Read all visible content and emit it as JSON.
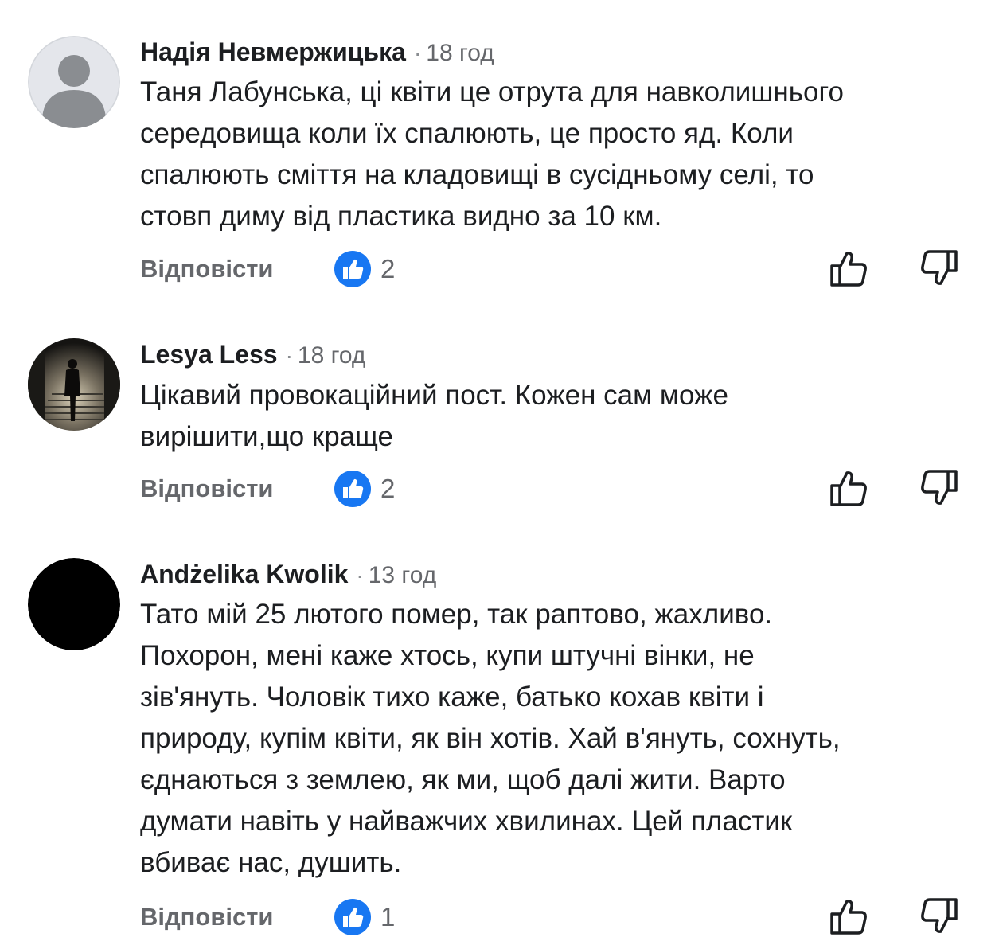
{
  "comments": [
    {
      "author": "Надія Невмержицька",
      "time": "18 год",
      "lines": [
        "Таня Лабунська, ці квіти це отрута для навколишнього",
        "середовища коли їх спалюють, це просто яд. Коли",
        "спалюють сміття на кладовищі в сусідньому селі, то",
        "стовп диму від пластика видно за 10 км."
      ],
      "reply_label": "Відповісти",
      "like_count": "2",
      "avatar": "default-person-avatar"
    },
    {
      "author": "Lesya Less",
      "time": "18 год",
      "lines": [
        "Цікавий провокаційний пост. Кожен сам може",
        "вирішити,що краще"
      ],
      "reply_label": "Відповісти",
      "like_count": "2",
      "avatar": "photo-avatar-stairs"
    },
    {
      "author": "Andżelika Kwolik",
      "time": "13 год",
      "lines": [
        "Тато мій 25 лютого помер, так раптово, жахливо.",
        "Похорон, мені каже хтось, купи штучні вінки, не",
        "зів'януть. Чоловік тихо каже, батько кохав квіти і",
        "природу, купім квіти, як він хотів. Хай в'януть, сохнуть,",
        "єднаються з землею, як ми, щоб далі жити. Варто",
        "думати навіть у найважчих хвилинах. Цей пластик",
        "вбиває нас, душить."
      ],
      "reply_label": "Відповісти",
      "like_count": "1",
      "avatar": "black-avatar"
    }
  ],
  "separator": "·",
  "colors": {
    "like_badge": "#1877f2",
    "secondary_text": "#65676b",
    "primary_text": "#1c1e21"
  }
}
